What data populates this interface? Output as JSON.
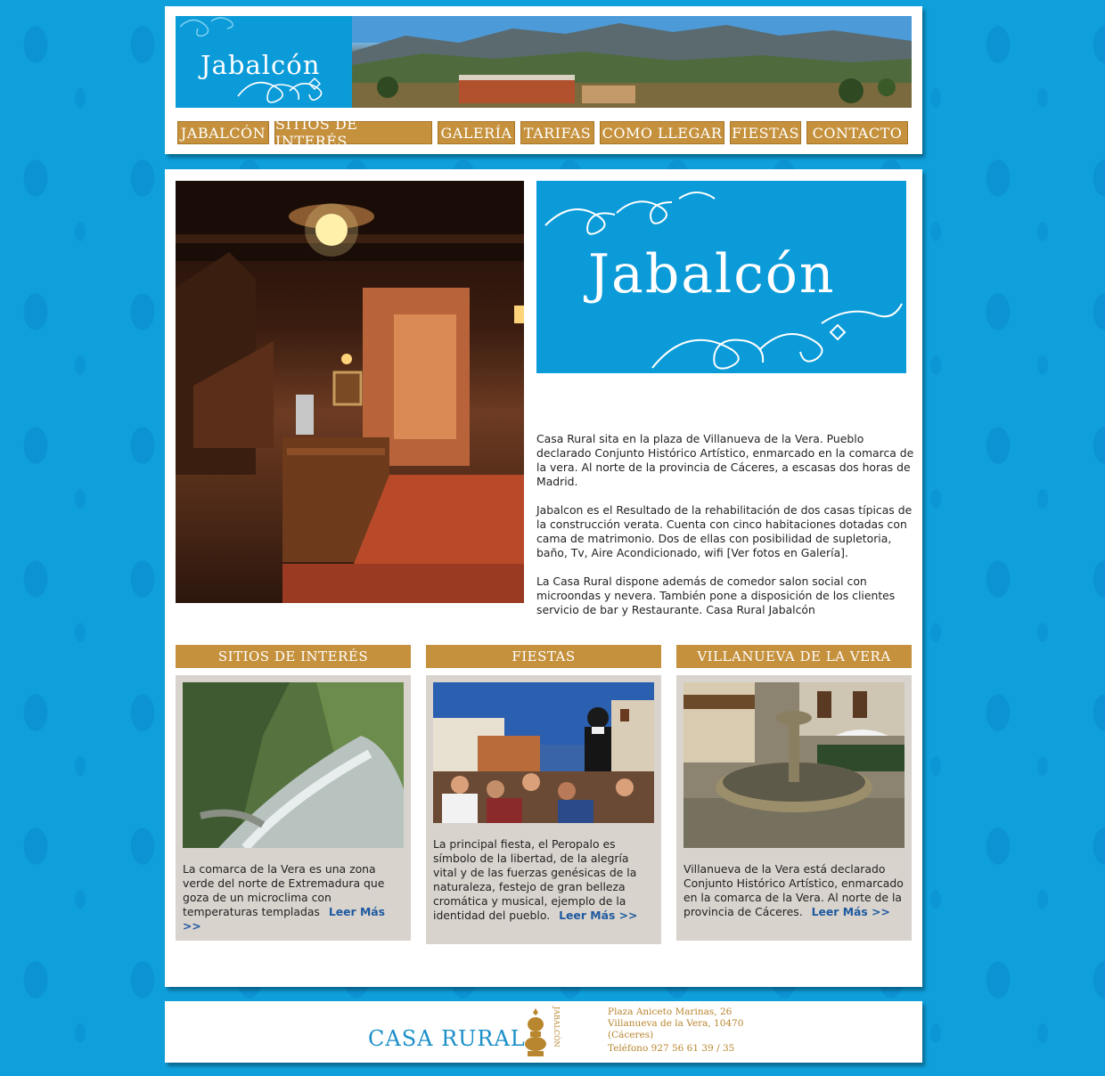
{
  "brand": {
    "logo_text": "Jabalcón"
  },
  "nav": {
    "items": [
      {
        "label": "Jabalcón"
      },
      {
        "label": "Sitios de interés"
      },
      {
        "label": "Galería"
      },
      {
        "label": "Tarifas"
      },
      {
        "label": "Como llegar"
      },
      {
        "label": "Fiestas"
      },
      {
        "label": "Contacto"
      }
    ]
  },
  "main": {
    "logo_text": "Jabalcón",
    "intro": [
      "Casa Rural sita en la plaza de Villanueva de la Vera. Pueblo declarado Conjunto Histórico Artístico, enmarcado en la comarca de la vera. Al norte de la provincia de Cáceres, a escasas dos horas de Madrid.",
      "Jabalcon es el Resultado de la rehabilitación de dos casas típicas de la construcción verata. Cuenta con cinco habitaciones dotadas con cama de matrimonio. Dos de ellas con posibilidad de supletoria, baño, Tv, Aire Acondicionado, wifi [Ver fotos en Galería].",
      "La Casa Rural dispone además de comedor salon social con microondas y nevera. También pone a disposición de los clientes servicio de bar y Restaurante. Casa Rural Jabalcón"
    ]
  },
  "cards": [
    {
      "title": "Sitios de interés",
      "text": "La comarca de la Vera es una zona verde del norte de Extremadura que goza de un microclima con temperaturas templadas",
      "link": "Leer Más >>"
    },
    {
      "title": "Fiestas",
      "text": "La principal fiesta, el Peropalo es símbolo de la libertad, de la alegría vital y de las fuerzas genésicas de la naturaleza, festejo de gran belleza cromática y musical, ejemplo de la identidad del pueblo.",
      "link": "Leer Más >>"
    },
    {
      "title": "Villanueva de la Vera",
      "text": "Villanueva de la Vera está declarado Conjunto Histórico Artístico, enmarcado en la comarca de la Vera. Al norte de la provincia de Cáceres.",
      "link": "Leer Más >>"
    }
  ],
  "footer": {
    "casa_rural": "Casa Rural",
    "emblem_label": "Jabalcón",
    "address_line1": "Plaza Aniceto Marinas, 26",
    "address_line2": "Villanueva de la Vera, 10470",
    "address_line3": "(Cáceres)",
    "phone": "Teléfono  927 56 61 39 / 35"
  },
  "colors": {
    "background": "#0fa0dc",
    "logo_blue": "#0b9bd9",
    "gold": "#c5913d",
    "card_bg": "#d8d3cd",
    "link": "#1f5aa0"
  }
}
